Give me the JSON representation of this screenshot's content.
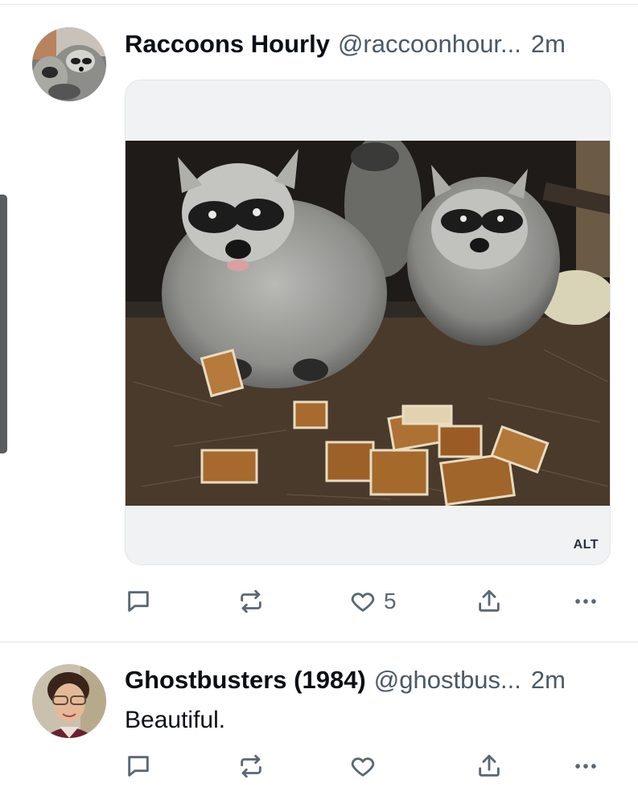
{
  "posts": [
    {
      "author_name": "Raccoons Hourly",
      "handle": "@raccoonhour...",
      "time": "2m",
      "media": {
        "alt_badge": "ALT"
      },
      "actions": {
        "like_count": "5"
      }
    },
    {
      "author_name": "Ghostbusters (1984)",
      "handle": "@ghostbus...",
      "time": "2m",
      "text": "Beautiful.",
      "actions": {
        "like_count": ""
      }
    }
  ],
  "icons": [
    "reply-icon",
    "repost-icon",
    "like-icon",
    "share-icon",
    "more-icon"
  ],
  "colors": {
    "text": "#0b0f14",
    "secondary": "#4b5866",
    "icon": "#5b6773",
    "divider": "#e3e6e9",
    "card_bg": "#f0f2f4"
  }
}
